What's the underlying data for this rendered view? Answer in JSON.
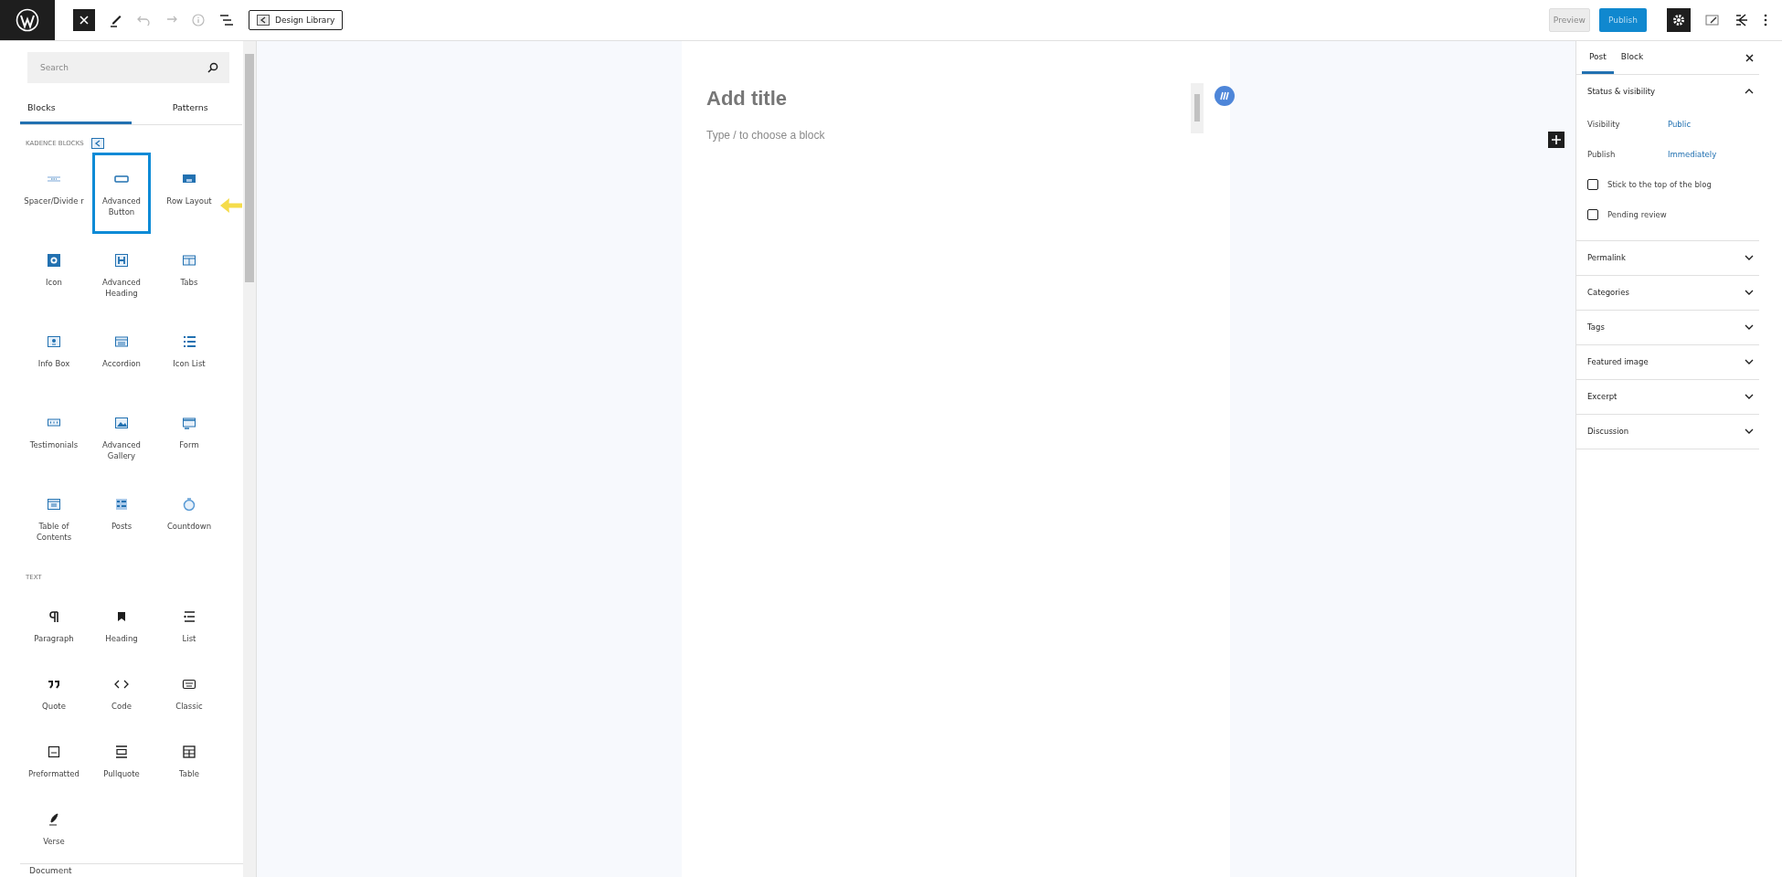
{
  "toolbar": {
    "design_library": "Design Library",
    "preview": "Preview",
    "publish": "Publish",
    "settings_selected": true
  },
  "inserter": {
    "search": {
      "placeholder": "Search"
    },
    "tabs": [
      {
        "label": "Blocks",
        "selected": true
      },
      {
        "label": "Patterns",
        "selected": false
      }
    ],
    "sections": [
      {
        "title": "KADENCE BLOCKS",
        "kind": "kadence",
        "blocks": [
          {
            "label": "Spacer/Divide r",
            "selected": false
          },
          {
            "label": "Advanced Button",
            "selected": true
          },
          {
            "label": "Row Layout",
            "selected": false
          },
          {
            "label": "Icon",
            "selected": false
          },
          {
            "label": "Advanced Heading",
            "selected": false
          },
          {
            "label": "Tabs",
            "selected": false
          },
          {
            "label": "Info Box",
            "selected": false
          },
          {
            "label": "Accordion",
            "selected": false
          },
          {
            "label": "Icon List",
            "selected": false
          },
          {
            "label": "Testimonials",
            "selected": false
          },
          {
            "label": "Advanced Gallery",
            "selected": false
          },
          {
            "label": "Form",
            "selected": false
          },
          {
            "label": "Table of Contents",
            "selected": false
          },
          {
            "label": "Posts",
            "selected": false
          },
          {
            "label": "Countdown",
            "selected": false
          }
        ]
      },
      {
        "title": "TEXT",
        "kind": "core",
        "blocks": [
          {
            "label": "Paragraph",
            "selected": false
          },
          {
            "label": "Heading",
            "selected": false
          },
          {
            "label": "List",
            "selected": false
          },
          {
            "label": "Quote",
            "selected": false
          },
          {
            "label": "Code",
            "selected": false
          },
          {
            "label": "Classic",
            "selected": false
          },
          {
            "label": "Preformatted",
            "selected": false
          },
          {
            "label": "Pullquote",
            "selected": false
          },
          {
            "label": "Table",
            "selected": false
          },
          {
            "label": "Verse",
            "selected": false
          }
        ]
      }
    ]
  },
  "status_bar": "Document",
  "editor": {
    "title_placeholder": "Add title",
    "block_placeholder": "Type / to choose a block"
  },
  "sidebar": {
    "tabs": [
      {
        "label": "Post",
        "selected": true
      },
      {
        "label": "Block",
        "selected": false
      }
    ],
    "panels": [
      {
        "title": "Status & visibility",
        "expanded": true,
        "rows": [
          {
            "label": "Visibility",
            "value": "Public"
          },
          {
            "label": "Publish",
            "value": "Immediately"
          }
        ],
        "checkboxes": [
          {
            "label": "Stick to the top of the blog",
            "checked": false
          },
          {
            "label": "Pending review",
            "checked": false
          }
        ]
      },
      {
        "title": "Permalink",
        "expanded": false
      },
      {
        "title": "Categories",
        "expanded": false
      },
      {
        "title": "Tags",
        "expanded": false
      },
      {
        "title": "Featured image",
        "expanded": false
      },
      {
        "title": "Excerpt",
        "expanded": false
      },
      {
        "title": "Discussion",
        "expanded": false
      }
    ]
  }
}
